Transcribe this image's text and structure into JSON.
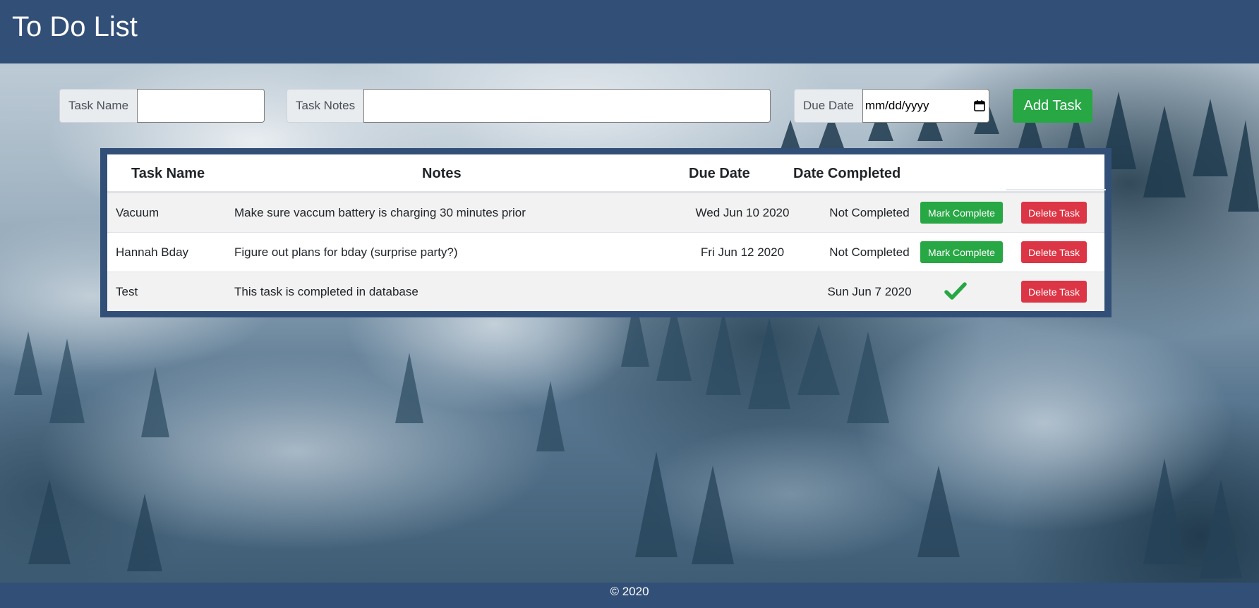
{
  "header": {
    "title": "To Do List"
  },
  "form": {
    "task_name_label": "Task Name",
    "task_name_value": "",
    "task_notes_label": "Task Notes",
    "task_notes_value": "",
    "due_date_label": "Due Date",
    "due_date_placeholder": "mm/dd/yyyy",
    "add_button_label": "Add Task"
  },
  "table": {
    "columns": [
      "Task Name",
      "Notes",
      "Due Date",
      "Date Completed"
    ],
    "rows": [
      {
        "name": "Vacuum",
        "notes": "Make sure vaccum battery is charging 30 minutes prior",
        "due_date": "Wed Jun 10 2020",
        "date_completed": "Not Completed",
        "completed": false,
        "action_label": "Mark Complete",
        "delete_label": "Delete Task"
      },
      {
        "name": "Hannah Bday",
        "notes": "Figure out plans for bday (surprise party?)",
        "due_date": "Fri Jun 12 2020",
        "date_completed": "Not Completed",
        "completed": false,
        "action_label": "Mark Complete",
        "delete_label": "Delete Task"
      },
      {
        "name": "Test",
        "notes": "This task is completed in database",
        "due_date": "",
        "date_completed": "Sun Jun 7 2020",
        "completed": true,
        "action_icon": "checkmark-icon",
        "delete_label": "Delete Task"
      }
    ]
  },
  "footer": {
    "copyright": "© 2020"
  },
  "colors": {
    "header_bg": "#324f77",
    "success": "#28a745",
    "danger": "#dc3545",
    "striped_row": "#f2f2f2"
  }
}
